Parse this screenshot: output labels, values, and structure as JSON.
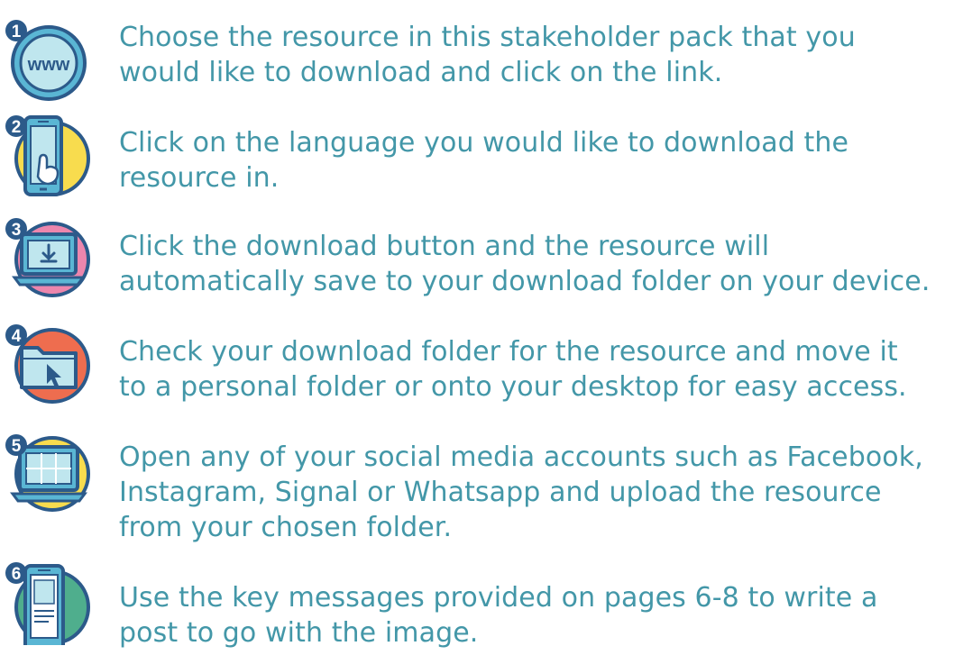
{
  "steps": [
    {
      "number": "1",
      "icon": "www-globe-icon",
      "lines": [
        "Choose the resource in this stakeholder pack that you",
        "would like to download and click on the link."
      ],
      "icon_text": "www"
    },
    {
      "number": "2",
      "icon": "phone-tap-icon",
      "lines": [
        "Click on the language you would like to download the",
        "resource in."
      ]
    },
    {
      "number": "3",
      "icon": "laptop-download-icon",
      "lines": [
        "Click the download button and the resource will",
        "automatically save to your download folder on your device."
      ]
    },
    {
      "number": "4",
      "icon": "folder-cursor-icon",
      "lines": [
        "Check your download folder for the resource and move it",
        "to a personal folder or onto your desktop for easy access."
      ]
    },
    {
      "number": "5",
      "icon": "laptop-gallery-icon",
      "lines": [
        "Open any of your social media accounts such as Facebook,",
        "Instagram, Signal or Whatsapp and upload the resource",
        "from your chosen folder."
      ]
    },
    {
      "number": "6",
      "icon": "phone-post-icon",
      "lines": [
        "Use the key messages provided on pages 6-8 to write a",
        "post to go with the image."
      ]
    }
  ],
  "colors": {
    "text": "#4397a8",
    "outline": "#2c5a8a",
    "screen": "#bfe6ee",
    "blue": "#5ab6d4",
    "yellow": "#f8dc4e",
    "pink": "#ec86ad",
    "orange": "#ee6d4f",
    "green": "#4fae8d"
  }
}
